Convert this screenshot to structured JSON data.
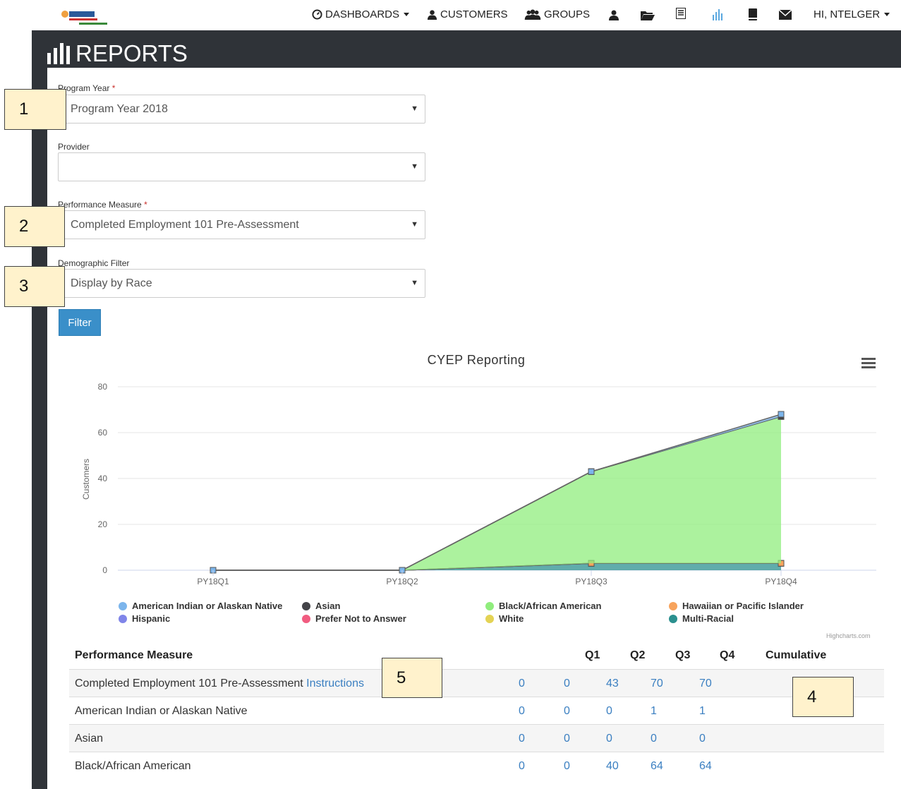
{
  "nav": {
    "dashboards": "DASHBOARDS",
    "customers": "CUSTOMERS",
    "groups": "GROUPS",
    "user_greeting": "HI, NTELGER"
  },
  "page": {
    "title": "REPORTS"
  },
  "form": {
    "program_year": {
      "label": "Program Year",
      "required": "*",
      "value": "Program Year 2018"
    },
    "provider": {
      "label": "Provider",
      "value": ""
    },
    "performance_measure": {
      "label": "Performance Measure",
      "required": "*",
      "value": "Completed Employment 101 Pre-Assessment"
    },
    "demographic_filter": {
      "label": "Demographic Filter",
      "value": "Display by Race"
    },
    "filter_button": "Filter"
  },
  "callouts": [
    "1",
    "2",
    "3",
    "4",
    "5"
  ],
  "chart_data": {
    "type": "area",
    "title": "CYEP Reporting",
    "ylabel": "Customers",
    "xlabel": "",
    "ylim": [
      0,
      80
    ],
    "yticks": [
      0,
      20,
      40,
      60,
      80
    ],
    "categories": [
      "PY18Q1",
      "PY18Q2",
      "PY18Q3",
      "PY18Q4"
    ],
    "stacked": true,
    "grid": true,
    "legend_position": "bottom",
    "series": [
      {
        "name": "American Indian or Alaskan Native",
        "color": "#7cb5ec",
        "values": [
          0,
          0,
          0,
          1
        ]
      },
      {
        "name": "Asian",
        "color": "#434348",
        "values": [
          0,
          0,
          0,
          0
        ]
      },
      {
        "name": "Black/African American",
        "color": "#90ed7d",
        "values": [
          0,
          0,
          40,
          64
        ]
      },
      {
        "name": "Hawaiian or Pacific Islander",
        "color": "#f7a35c",
        "values": [
          0,
          0,
          0,
          0
        ]
      },
      {
        "name": "Hispanic",
        "color": "#8085e9",
        "values": [
          0,
          0,
          0,
          0
        ]
      },
      {
        "name": "Prefer Not to Answer",
        "color": "#f15c80",
        "values": [
          0,
          0,
          0,
          0
        ]
      },
      {
        "name": "White",
        "color": "#e4d354",
        "values": [
          0,
          0,
          0,
          0
        ]
      },
      {
        "name": "Multi-Racial",
        "color": "#2b908f",
        "values": [
          0,
          0,
          3,
          3
        ]
      }
    ],
    "credits": "Highcharts.com"
  },
  "table": {
    "headers": [
      "Performance Measure",
      "Q1",
      "Q2",
      "Q3",
      "Q4",
      "Cumulative"
    ],
    "rows": [
      {
        "label": "Completed Employment 101 Pre-Assessment",
        "link": "Instructions",
        "values": [
          "0",
          "0",
          "43",
          "70",
          "70"
        ]
      },
      {
        "label": "American Indian or Alaskan Native",
        "link": "",
        "values": [
          "0",
          "0",
          "0",
          "1",
          "1"
        ]
      },
      {
        "label": "Asian",
        "link": "",
        "values": [
          "0",
          "0",
          "0",
          "0",
          "0"
        ]
      },
      {
        "label": "Black/African American",
        "link": "",
        "values": [
          "0",
          "0",
          "40",
          "64",
          "64"
        ]
      }
    ]
  }
}
